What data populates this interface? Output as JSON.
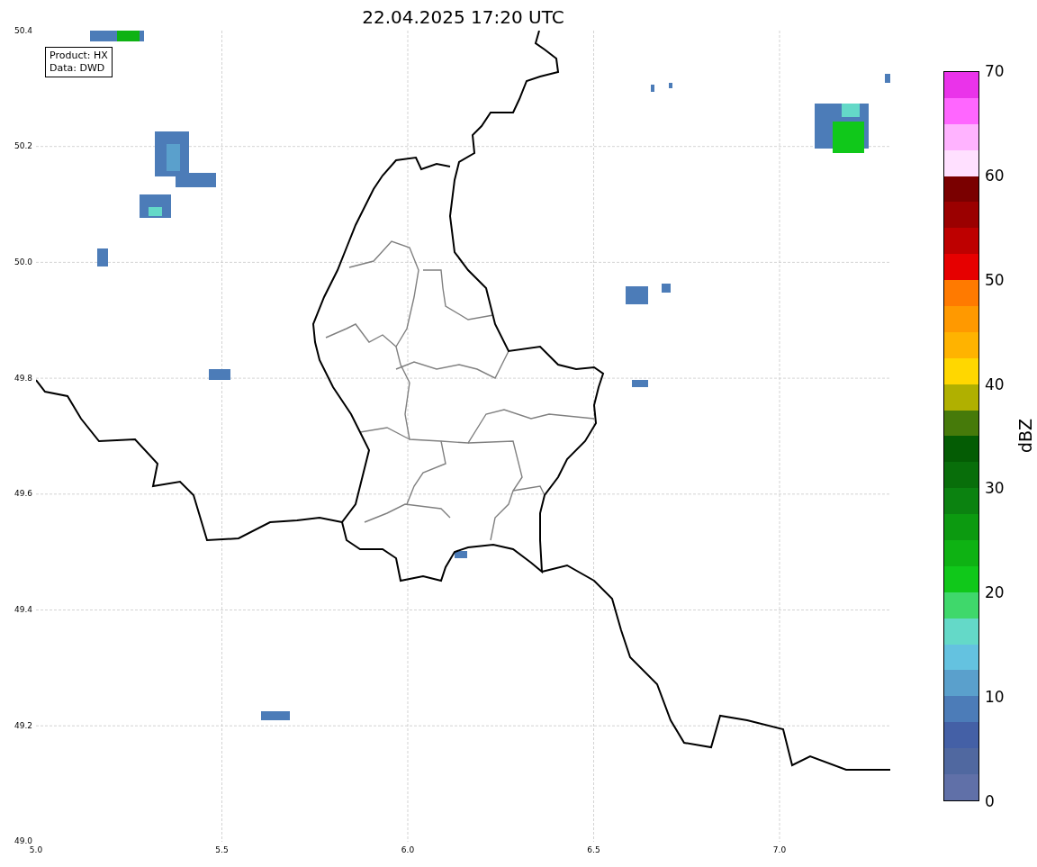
{
  "title": "22.04.2025 17:20 UTC",
  "info_box": [
    "Product: HX",
    "Data: DWD"
  ],
  "x_ticks": [
    "5.0",
    "5.5",
    "6.0",
    "6.5",
    "7.0"
  ],
  "y_ticks": [
    "50.4",
    "50.2",
    "50.0",
    "49.8",
    "49.6",
    "49.4",
    "49.2",
    "49.0"
  ],
  "colorbar": {
    "label": "dBZ",
    "ticks": [
      "70",
      "60",
      "50",
      "40",
      "30",
      "20",
      "10",
      "0"
    ],
    "bands": [
      {
        "color": "#ea33ea"
      },
      {
        "color": "#ff66ff"
      },
      {
        "color": "#ffb3ff"
      },
      {
        "color": "#ffe0ff"
      },
      {
        "color": "#7a0000"
      },
      {
        "color": "#9b0000"
      },
      {
        "color": "#be0000"
      },
      {
        "color": "#e60000"
      },
      {
        "color": "#ff7a00"
      },
      {
        "color": "#ff9900"
      },
      {
        "color": "#ffb300"
      },
      {
        "color": "#ffd700"
      },
      {
        "color": "#b0b000"
      },
      {
        "color": "#467a0a"
      },
      {
        "color": "#045c04"
      },
      {
        "color": "#086e0a"
      },
      {
        "color": "#0b8210"
      },
      {
        "color": "#0c9a10"
      },
      {
        "color": "#0eb213"
      },
      {
        "color": "#10c81a"
      },
      {
        "color": "#3fd86b"
      },
      {
        "color": "#64d9c8"
      },
      {
        "color": "#64c2e0"
      },
      {
        "color": "#5aa0cc"
      },
      {
        "color": "#4c7cb8"
      },
      {
        "color": "#4460a6"
      },
      {
        "color": "#5068a0"
      },
      {
        "color": "#6070a8"
      }
    ]
  }
}
